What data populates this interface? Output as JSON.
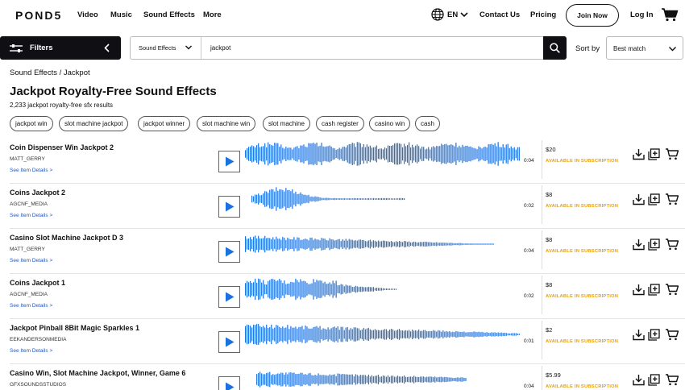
{
  "nav": {
    "logo": "POND5",
    "links": [
      "Video",
      "Music",
      "Sound Effects",
      "More"
    ],
    "lang": "EN",
    "contact": "Contact Us",
    "pricing": "Pricing",
    "join": "Join Now",
    "login": "Log In"
  },
  "search": {
    "filters_label": "Filters",
    "category": "Sound Effects",
    "query": "jackpot",
    "sort_label": "Sort by",
    "sort_value": "Best match"
  },
  "breadcrumb": "Sound Effects / Jackpot",
  "heading": "Jackpot Royalty-Free Sound Effects",
  "result_count": "2,233 jackpot royalty-free sfx results",
  "tags": [
    "jackpot win",
    "slot machine jackpot",
    "jackpot winner",
    "slot machine win",
    "slot machine",
    "cash register",
    "casino win",
    "cash"
  ],
  "details_label": "See Item Details >",
  "subscription_label": "AVAILABLE IN SUBSCRIPTION",
  "accent_color": "#1a72e0",
  "subscription_color": "#f0a000",
  "results": [
    {
      "title": "Coin Dispenser Win Jackpot 2",
      "artist": "MATT_GERRY",
      "duration": "0:04",
      "price": "$20"
    },
    {
      "title": "Coins Jackpot 2",
      "artist": "AGCNF_MEDIA",
      "duration": "0:02",
      "price": "$8"
    },
    {
      "title": "Casino Slot Machine Jackpot D 3",
      "artist": "MATT_GERRY",
      "duration": "0:04",
      "price": "$8"
    },
    {
      "title": "Coins Jackpot 1",
      "artist": "AGCNF_MEDIA",
      "duration": "0:02",
      "price": "$8"
    },
    {
      "title": "Jackpot Pinball 8Bit Magic Sparkles 1",
      "artist": "EEKANDERSONMEDIA",
      "duration": "0:01",
      "price": "$2"
    },
    {
      "title": "Casino Win, Slot Machine Jackpot, Winner, Game 6",
      "artist": "GFXSOUNDSSTUDIOS",
      "duration": "0:04",
      "price": "$5.99"
    }
  ]
}
